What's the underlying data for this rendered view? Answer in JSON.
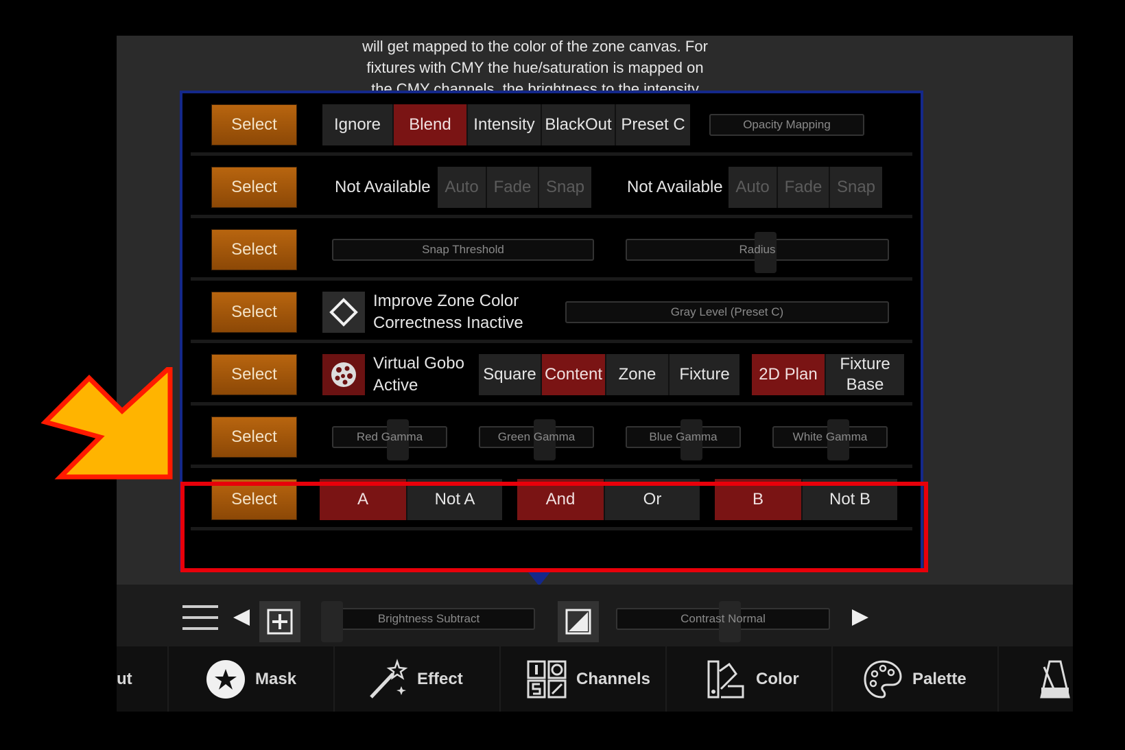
{
  "help_text": [
    "will get mapped to the color of the zone canvas. For",
    "fixtures with CMY the hue/saturation is mapped on",
    "the CMY channels, the brightness to the intensity"
  ],
  "select_label": "Select",
  "rows": {
    "row1": {
      "options": [
        "Ignore",
        "Blend",
        "Intensity",
        "BlackOut",
        "Preset C"
      ],
      "slider": "Opacity Mapping"
    },
    "row2": {
      "left_label": "Not Available",
      "left_options": [
        "Auto",
        "Fade",
        "Snap"
      ],
      "right_label": "Not Available",
      "right_options": [
        "Auto",
        "Fade",
        "Snap"
      ]
    },
    "row3": {
      "slider1": "Snap Threshold",
      "slider2": "Radius"
    },
    "row4": {
      "label_line1": "Improve Zone Color",
      "label_line2": "Correctness Inactive",
      "slider": "Gray Level (Preset C)"
    },
    "row5": {
      "label_line1": "Virtual Gobo",
      "label_line2": "Active",
      "options": [
        "Square",
        "Content",
        "Zone",
        "Fixture"
      ],
      "options2": [
        "2D Plan",
        "Fixture Base"
      ]
    },
    "row6": {
      "sliders": [
        "Red Gamma",
        "Green Gamma",
        "Blue Gamma",
        "White Gamma"
      ]
    },
    "row7": {
      "options_a": [
        "A",
        "Not A"
      ],
      "options_op": [
        "And",
        "Or"
      ],
      "options_b": [
        "B",
        "Not B"
      ]
    }
  },
  "bottom": {
    "slider1": "Brightness Subtract",
    "slider2": "Contrast Normal"
  },
  "tabs": [
    "ut",
    "Mask",
    "Effect",
    "Channels",
    "Color",
    "Palette"
  ],
  "colors": {
    "accent_orange": "#b8650f",
    "active_red": "#7a1414",
    "panel_border": "#14288a",
    "highlight_red": "#e8000a",
    "arrow_yellow": "#ffb400"
  }
}
